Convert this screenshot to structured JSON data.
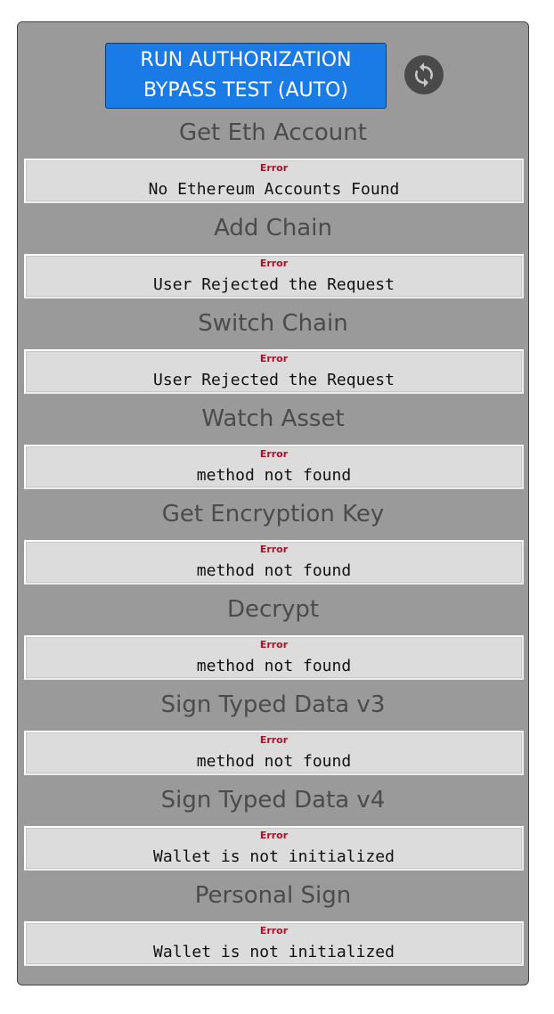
{
  "header": {
    "run_button_label": "RUN AUTHORIZATION BYPASS TEST (AUTO)",
    "refresh_icon": "refresh-icon"
  },
  "colors": {
    "accent_button": "#1a7be6",
    "panel_background": "#9a9a9a",
    "error_label": "#b0102a"
  },
  "tests": [
    {
      "title": "Get Eth Account",
      "status": "Error",
      "message": "No Ethereum Accounts Found"
    },
    {
      "title": "Add Chain",
      "status": "Error",
      "message": "User Rejected the Request"
    },
    {
      "title": "Switch Chain",
      "status": "Error",
      "message": "User Rejected the Request"
    },
    {
      "title": "Watch Asset",
      "status": "Error",
      "message": "method not found"
    },
    {
      "title": "Get Encryption Key",
      "status": "Error",
      "message": "method not found"
    },
    {
      "title": "Decrypt",
      "status": "Error",
      "message": "method not found"
    },
    {
      "title": "Sign Typed Data v3",
      "status": "Error",
      "message": "method not found"
    },
    {
      "title": "Sign Typed Data v4",
      "status": "Error",
      "message": "Wallet is not initialized"
    },
    {
      "title": "Personal Sign",
      "status": "Error",
      "message": "Wallet is not initialized"
    }
  ]
}
